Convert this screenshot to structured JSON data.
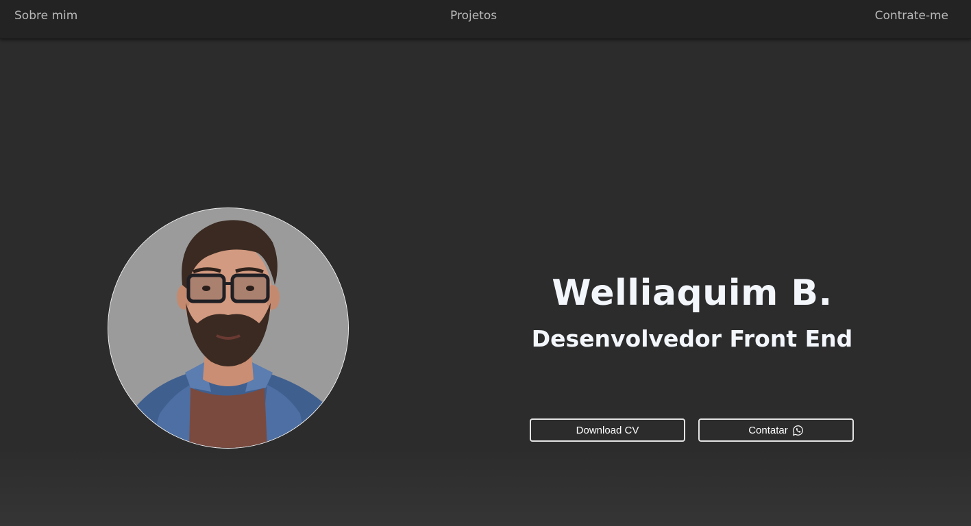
{
  "nav": {
    "about": "Sobre mim",
    "projects": "Projetos",
    "hire": "Contrate-me"
  },
  "hero": {
    "name": "Welliaquim B.",
    "role": "Desenvolvedor Front End",
    "avatar_alt": "profile photo",
    "buttons": {
      "download": "Download CV",
      "contact": "Contatar",
      "contact_icon": "whatsapp-icon"
    }
  },
  "colors": {
    "background": "#2c2c2c",
    "navbar": "#232323",
    "nav_text": "#b9b9b9",
    "heading": "#f3f6fb",
    "button_border": "#e4e4e4"
  }
}
